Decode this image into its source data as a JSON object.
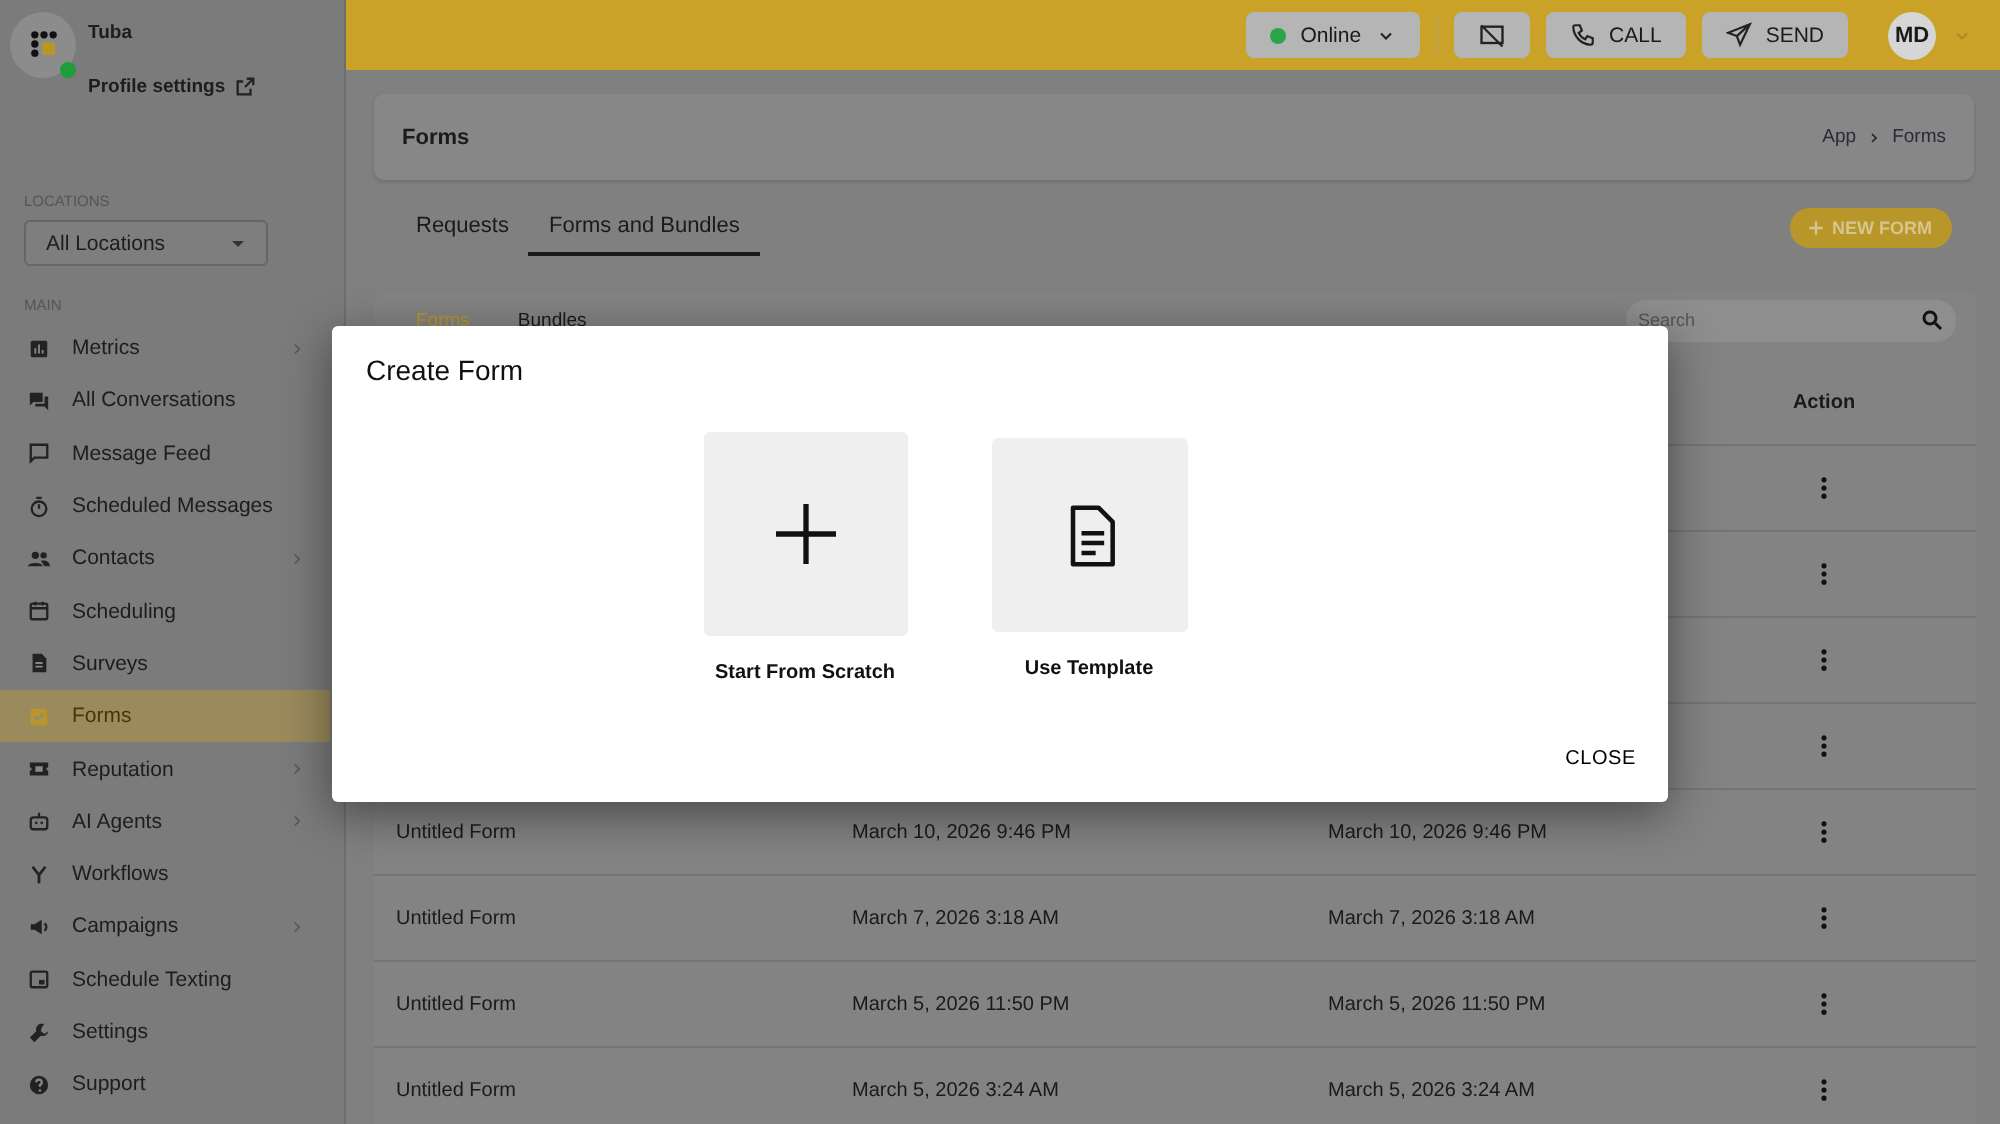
{
  "sidebar": {
    "workspace": "Tuba",
    "online": true,
    "profile_link": "Profile settings",
    "locations_label": "LOCATIONS",
    "location_select": "All Locations",
    "section_label": "MAIN",
    "items": [
      {
        "label": "Metrics",
        "has_submenu": true,
        "selected": false
      },
      {
        "label": "All Conversations",
        "has_submenu": false,
        "selected": false
      },
      {
        "label": "Message Feed",
        "has_submenu": false,
        "selected": false
      },
      {
        "label": "Scheduled Messages",
        "has_submenu": false,
        "selected": false
      },
      {
        "label": "Contacts",
        "has_submenu": true,
        "selected": false
      },
      {
        "label": "Scheduling",
        "has_submenu": false,
        "selected": false
      },
      {
        "label": "Surveys",
        "has_submenu": false,
        "selected": false
      },
      {
        "label": "Forms",
        "has_submenu": false,
        "selected": true
      },
      {
        "label": "Reputation",
        "has_submenu": true,
        "selected": false
      },
      {
        "label": "AI Agents",
        "has_submenu": true,
        "selected": false
      },
      {
        "label": "Workflows",
        "has_submenu": false,
        "selected": false
      },
      {
        "label": "Campaigns",
        "has_submenu": true,
        "selected": false
      },
      {
        "label": "Schedule Texting",
        "has_submenu": false,
        "selected": false
      },
      {
        "label": "Settings",
        "has_submenu": false,
        "selected": false
      },
      {
        "label": "Support",
        "has_submenu": false,
        "selected": false
      }
    ]
  },
  "topbar": {
    "status": "Online",
    "call": "CALL",
    "send": "SEND",
    "avatar": "MD"
  },
  "header": {
    "title": "Forms",
    "breadcrumb": [
      "App",
      "Forms"
    ]
  },
  "tabs": [
    {
      "label": "Requests",
      "selected": false
    },
    {
      "label": "Forms and Bundles",
      "selected": true
    }
  ],
  "new_form_button": "NEW FORM",
  "subtabs": [
    {
      "label": "Forms",
      "selected": true
    },
    {
      "label": "Bundles",
      "selected": false
    }
  ],
  "search": {
    "placeholder": "Search"
  },
  "table": {
    "action_column": "Action",
    "rows": [
      {
        "kind": "covered"
      },
      {
        "kind": "covered"
      },
      {
        "kind": "covered"
      },
      {
        "kind": "covered"
      },
      {
        "kind": "form",
        "name": "Untitled Form",
        "created": "March 10, 2026 9:46 PM",
        "updated": "March 10, 2026 9:46 PM"
      },
      {
        "kind": "form",
        "name": "Untitled Form",
        "created": "March 7, 2026 3:18 AM",
        "updated": "March 7, 2026 3:18 AM"
      },
      {
        "kind": "form",
        "name": "Untitled Form",
        "created": "March 5, 2026 11:50 PM",
        "updated": "March 5, 2026 11:50 PM"
      },
      {
        "kind": "form",
        "name": "Untitled Form",
        "created": "March 5, 2026 3:24 AM",
        "updated": "March 5, 2026 3:24 AM"
      }
    ]
  },
  "dialog": {
    "title": "Create Form",
    "options": [
      {
        "kind": "scratch",
        "label": "Start From Scratch"
      },
      {
        "kind": "template",
        "label": "Use Template"
      }
    ],
    "close": "CLOSE"
  }
}
